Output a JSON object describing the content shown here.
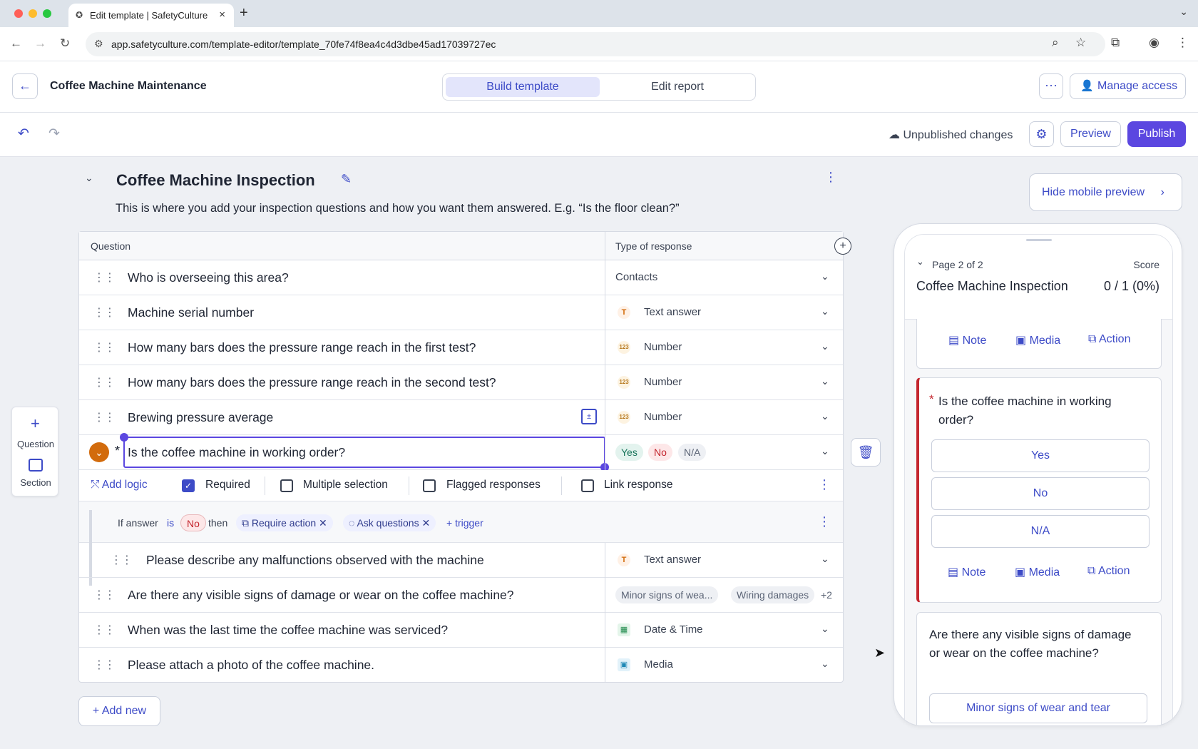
{
  "browser": {
    "tab_title": "Edit template | SafetyCulture",
    "url": "app.safetyculture.com/template-editor/template_70fe74f8ea4c4d3dbe45ad17039727ec"
  },
  "header": {
    "template_name": "Coffee Machine Maintenance",
    "tabs": [
      "Build template",
      "Edit report"
    ],
    "manage_access": "Manage access"
  },
  "toolbar": {
    "status": "Unpublished changes",
    "preview": "Preview",
    "publish": "Publish"
  },
  "section": {
    "title": "Coffee Machine Inspection",
    "description": "This is where you add your inspection questions and how you want them answered. E.g. “Is the floor clean?”"
  },
  "table": {
    "col_question": "Question",
    "col_type": "Type of response",
    "rows": [
      {
        "question": "Who is overseeing this area?",
        "type": "Contacts"
      },
      {
        "question": "Machine serial number",
        "type": "Text answer"
      },
      {
        "question": "How many bars does the pressure range reach in the first test?",
        "type": "Number"
      },
      {
        "question": "How many bars does the pressure range reach in the second test?",
        "type": "Number"
      },
      {
        "question": "Brewing pressure average",
        "type": "Number"
      },
      {
        "question": "Is the coffee machine in working order?",
        "responses": [
          "Yes",
          "No",
          "N/A"
        ]
      },
      {
        "question": "Please describe any malfunctions observed with the machine",
        "type": "Text answer"
      },
      {
        "question": "Are there any visible signs of damage or wear on the coffee machine?",
        "responses": [
          "Minor signs of wea...",
          "Wiring damages",
          "+2"
        ]
      },
      {
        "question": "When was the last time the coffee machine was serviced?",
        "type": "Date & Time"
      },
      {
        "question": "Please attach a photo of the coffee machine.",
        "type": "Media"
      }
    ],
    "options": {
      "add_logic": "Add logic",
      "required": "Required",
      "multiple": "Multiple selection",
      "flagged": "Flagged responses",
      "link": "Link response"
    },
    "logic": {
      "if_answer": "If answer",
      "is": "is",
      "value": "No",
      "then": "then",
      "require_action": "Require action",
      "ask_questions": "Ask questions",
      "trigger": "+ trigger"
    }
  },
  "add_new": "Add new",
  "side_tools": {
    "question": "Question",
    "section": "Section"
  },
  "mobile": {
    "hide": "Hide mobile preview",
    "page": "Page 2 of 2",
    "score_label": "Score",
    "title": "Coffee Machine Inspection",
    "score": "0 / 1 (0%)",
    "actions": [
      "Note",
      "Media",
      "Action"
    ],
    "question1": "Is the coffee machine in working order?",
    "answers1": [
      "Yes",
      "No",
      "N/A"
    ],
    "question2": "Are there any visible signs of damage or wear on the coffee machine?",
    "answer2_first": "Minor signs of wear and tear"
  },
  "colors": {
    "accent": "#5b47e0",
    "link": "#3d4bc7",
    "flag_red": "#c4262e",
    "orange": "#d26b0c"
  }
}
